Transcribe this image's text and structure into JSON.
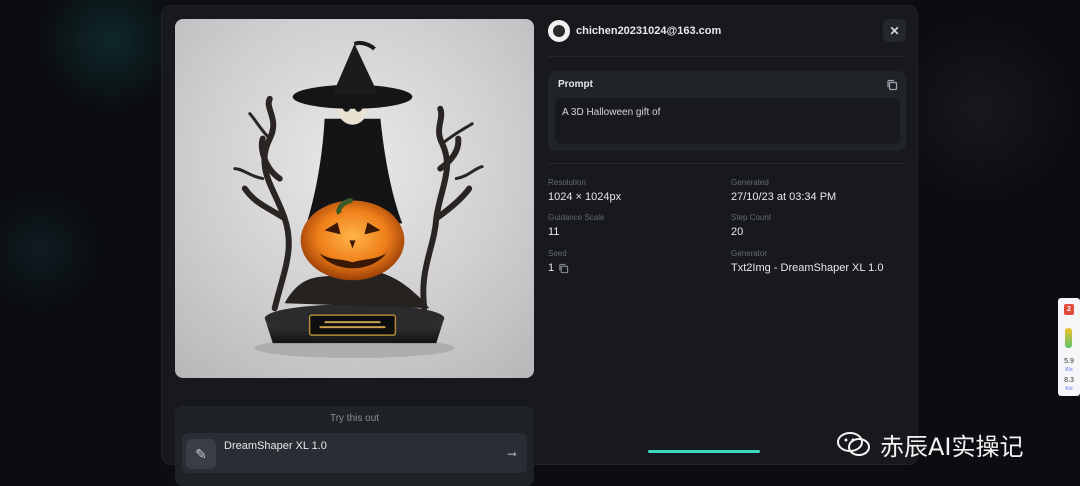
{
  "user": {
    "email": "chichen20231024@163.com"
  },
  "prompt": {
    "label": "Prompt",
    "text": "A 3D Halloween gift of"
  },
  "meta": {
    "resolution": {
      "label": "Resolution",
      "value": "1024 × 1024px"
    },
    "generated": {
      "label": "Generated",
      "value": "27/10/23 at 03:34 PM"
    },
    "guidance": {
      "label": "Guidance Scale",
      "value": "11"
    },
    "steps": {
      "label": "Step Count",
      "value": "20"
    },
    "seed": {
      "label": "Seed",
      "value": "1"
    },
    "generator": {
      "label": "Generator",
      "value": "Txt2Img - DreamShaper XL 1.0"
    }
  },
  "try_section": {
    "title": "Try this out",
    "model_name": "DreamShaper XL 1.0"
  },
  "side_widget": {
    "badge": "2",
    "down_value": "5.9",
    "down_unit": "K/s",
    "up_value": "8.3",
    "up_unit": "K/s"
  },
  "watermark": {
    "text": "赤辰AI实操记"
  },
  "icons": {
    "close": "close-icon",
    "copy": "copy-icon",
    "arrow": "arrow-right-icon",
    "model": "model-thumbnail-icon"
  },
  "colors": {
    "modal_bg": "#17191d",
    "card_bg": "#202328",
    "accent": "#3dd6c0"
  }
}
